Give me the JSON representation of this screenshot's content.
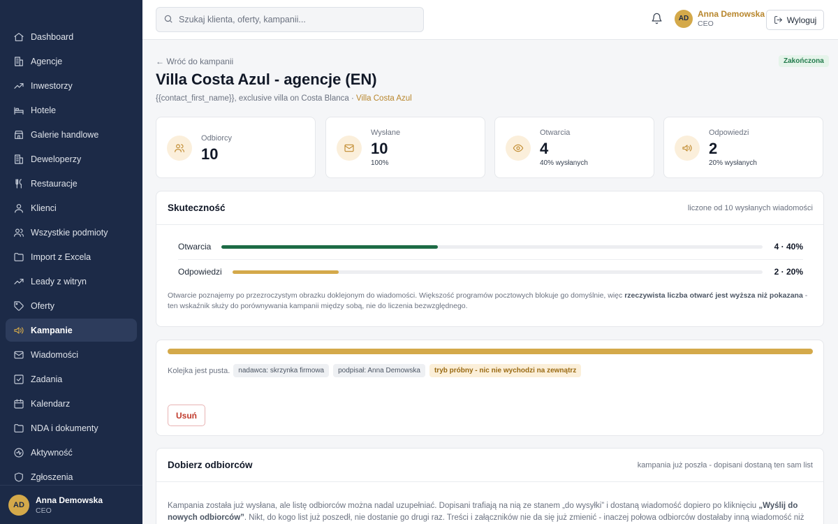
{
  "sidebar": {
    "items": [
      {
        "label": "Dashboard",
        "icon": "home-icon"
      },
      {
        "label": "Agencje",
        "icon": "building-icon"
      },
      {
        "label": "Inwestorzy",
        "icon": "trending-up-icon"
      },
      {
        "label": "Hotele",
        "icon": "bed-icon"
      },
      {
        "label": "Galerie handlowe",
        "icon": "store-icon"
      },
      {
        "label": "Deweloperzy",
        "icon": "building-icon"
      },
      {
        "label": "Restauracje",
        "icon": "utensils-icon"
      },
      {
        "label": "Klienci",
        "icon": "user-icon"
      },
      {
        "label": "Wszystkie podmioty",
        "icon": "users-icon"
      },
      {
        "label": "Import z Excela",
        "icon": "folder-icon"
      },
      {
        "label": "Leady z witryn",
        "icon": "trending-up-icon"
      },
      {
        "label": "Oferty",
        "icon": "tag-icon"
      },
      {
        "label": "Kampanie",
        "icon": "megaphone-icon"
      },
      {
        "label": "Wiadomości",
        "icon": "mail-icon"
      },
      {
        "label": "Zadania",
        "icon": "checkbox-icon"
      },
      {
        "label": "Kalendarz",
        "icon": "calendar-icon"
      },
      {
        "label": "NDA i dokumenty",
        "icon": "folder-icon"
      },
      {
        "label": "Aktywność",
        "icon": "activity-icon"
      },
      {
        "label": "Zgłoszenia",
        "icon": "shield-icon"
      }
    ],
    "active": "Kampanie",
    "user": {
      "initials": "AD",
      "name": "Anna Demowska",
      "role": "CEO"
    }
  },
  "topbar": {
    "search_placeholder": "Szukaj klienta, oferty, kampanii...",
    "user": {
      "initials": "AD",
      "name": "Anna Demowska",
      "role": "CEO"
    },
    "logout_label": "Wyloguj"
  },
  "page": {
    "back_label": "← Wróć do kampanii",
    "status": "Zakończona",
    "title": "Villa Costa Azul - agencje (EN)",
    "subtitle_text": "{{contact_first_name}}, exclusive villa on Costa Blanca · ",
    "subtitle_link": "Villa Costa Azul"
  },
  "stats": [
    {
      "label": "Odbiorcy",
      "value": "10",
      "sub": "",
      "icon": "users-icon"
    },
    {
      "label": "Wysłane",
      "value": "10",
      "sub": "100%",
      "icon": "mail-icon"
    },
    {
      "label": "Otwarcia",
      "value": "4",
      "sub": "40% wysłanych",
      "icon": "eye-icon"
    },
    {
      "label": "Odpowiedzi",
      "value": "2",
      "sub": "20% wysłanych",
      "icon": "megaphone-icon"
    }
  ],
  "effectiveness": {
    "title": "Skuteczność",
    "note_right": "liczone od 10 wysłanych wiadomości",
    "rows": [
      {
        "label": "Otwarcia",
        "value": "4 · 40%",
        "fraction": 0.4,
        "color": "#1d6b45"
      },
      {
        "label": "Odpowiedzi",
        "value": "2 · 20%",
        "fraction": 0.2,
        "color": "#d4a94a"
      }
    ],
    "note_a": "Otwarcie poznajemy po przezroczystym obrazku doklejonym do wiadomości. Większość programów pocztowych blokuje go domyślnie, więc ",
    "note_b": "rzeczywista liczba otwarć jest wyższa niż pokazana",
    "note_c": " - ten wskaźnik służy do porównywania kampanii między sobą, nie do liczenia bezwzględnego."
  },
  "queue": {
    "progress": 1.0,
    "text": "Kolejka jest pusta.",
    "chips": [
      "nadawca: skrzynka firmowa",
      "podpisał: Anna Demowska"
    ],
    "warn_chip": "tryb próbny - nic nie wychodzi na zewnątrz",
    "delete_label": "Usuń"
  },
  "recipients": {
    "title": "Dobierz odbiorców",
    "note_right": "kampania już poszła - dopisani dostaną ten sam list",
    "text_a": "Kampania została już wysłana, ale listę odbiorców można nadal uzupełniać. Dopisani trafiają na nią ze stanem „do wysyłki” i dostaną wiadomość dopiero po kliknięciu ",
    "text_b": "„Wyślij do nowych odbiorców”",
    "text_c": ". Nikt, do kogo list już poszedł, nie dostanie go drugi raz. Treści i załączników nie da się już zmienić - inaczej połowa odbiorców dostałaby inną wiadomość niż druga."
  },
  "colors": {
    "sidebar": "#1c2a47",
    "accent": "#d4a94a",
    "success": "#1d6b45"
  }
}
